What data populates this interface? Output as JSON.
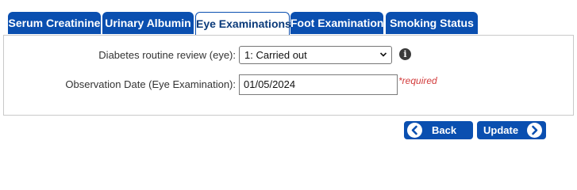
{
  "tabs": [
    {
      "label": "Serum Creatinine",
      "active": false
    },
    {
      "label": "Urinary Albumin",
      "active": false
    },
    {
      "label": "Eye Examinations",
      "active": true
    },
    {
      "label": "Foot Examinations",
      "active": false
    },
    {
      "label": "Smoking Status",
      "active": false
    }
  ],
  "form": {
    "review_label": "Diabetes routine review (eye):",
    "review_value": "1: Carried out",
    "date_label": "Observation Date (Eye Examination):",
    "date_value": "01/05/2024",
    "required_text": "*required"
  },
  "buttons": {
    "back_label": "Back",
    "update_label": "Update"
  },
  "icons": {
    "info": "info-icon",
    "back": "chevron-left-circle-icon",
    "update": "chevron-right-circle-icon",
    "select": "chevron-down-icon"
  },
  "colors": {
    "primary": "#0a4fb0",
    "required": "#d23b3b"
  }
}
